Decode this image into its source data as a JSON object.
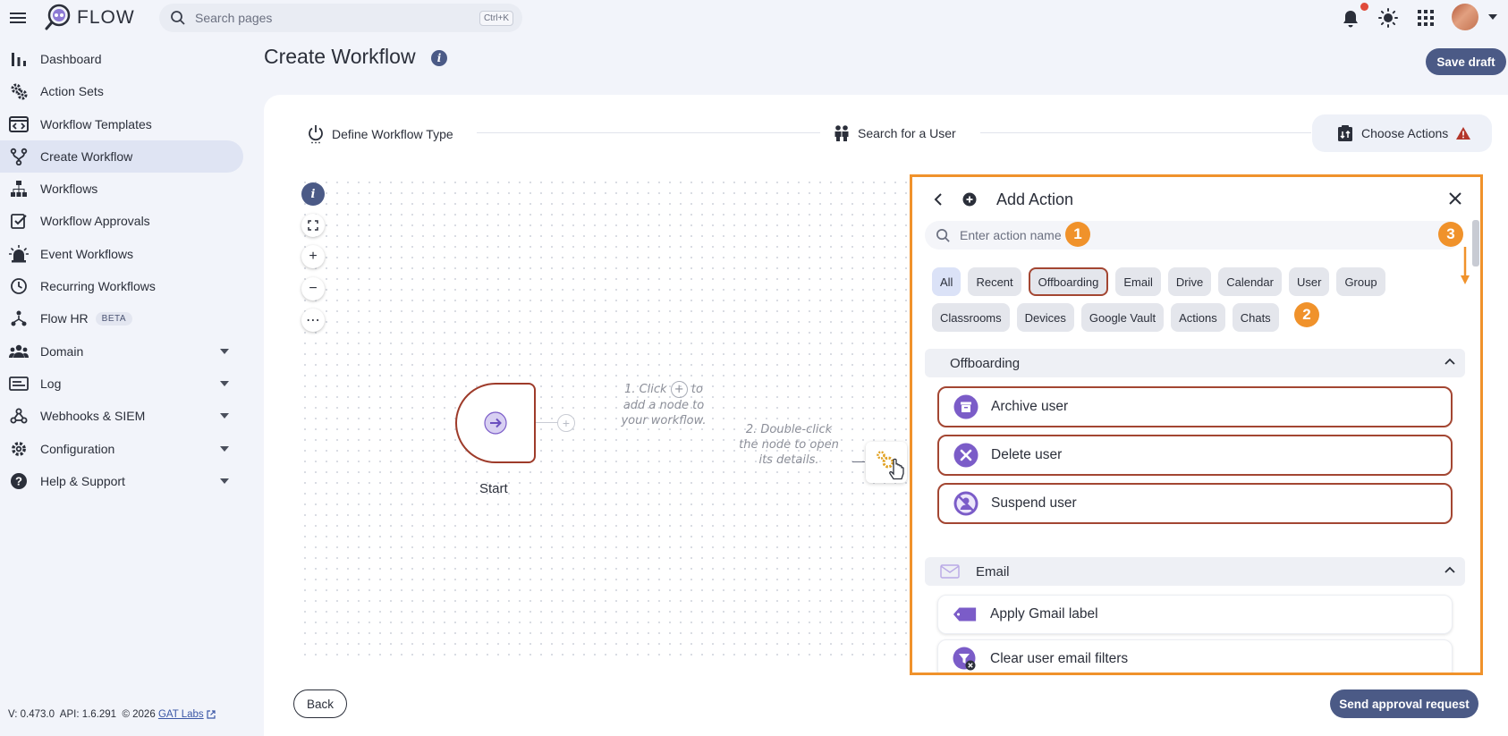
{
  "app": {
    "logo_text": "FLOW"
  },
  "search": {
    "placeholder": "Search pages",
    "shortcut": "Ctrl+K"
  },
  "sidebar": {
    "items": [
      {
        "label": "Dashboard"
      },
      {
        "label": "Action Sets"
      },
      {
        "label": "Workflow Templates"
      },
      {
        "label": "Create Workflow",
        "active": true
      },
      {
        "label": "Workflows"
      },
      {
        "label": "Workflow Approvals"
      },
      {
        "label": "Event Workflows"
      },
      {
        "label": "Recurring Workflows"
      },
      {
        "label": "Flow HR",
        "badge": "BETA"
      },
      {
        "label": "Domain"
      },
      {
        "label": "Log"
      },
      {
        "label": "Webhooks & SIEM"
      },
      {
        "label": "Configuration"
      },
      {
        "label": "Help & Support"
      }
    ]
  },
  "footer": {
    "version": "V: 0.473.0",
    "api": "API: 1.6.291",
    "copyright": "© 2026",
    "link": "GAT Labs"
  },
  "page": {
    "title": "Create Workflow",
    "info_glyph": "i",
    "save_draft": "Save draft"
  },
  "stepper": {
    "steps": [
      {
        "label": "Define Workflow Type"
      },
      {
        "label": "Search for a User"
      },
      {
        "label": "Choose Actions",
        "active": true,
        "warning": true
      }
    ]
  },
  "canvas": {
    "tools": [
      "i",
      "fit",
      "+",
      "−",
      "⋯"
    ],
    "start_label": "Start",
    "hint1": [
      "1. Click",
      "to",
      "add a node to",
      "your workflow."
    ],
    "hint2": [
      "2. Double-click",
      "the node to open",
      "its details."
    ]
  },
  "buttons": {
    "back": "Back",
    "send": "Send approval request"
  },
  "panel": {
    "title": "Add Action",
    "search_placeholder": "Enter action name",
    "badges": [
      "1",
      "2",
      "3"
    ],
    "chips": [
      "All",
      "Recent",
      "Offboarding",
      "Email",
      "Drive",
      "Calendar",
      "User",
      "Group",
      "Classrooms",
      "Devices",
      "Google Vault",
      "Actions",
      "Chats"
    ],
    "selected_chip": "Offboarding",
    "sections": [
      {
        "label": "Offboarding",
        "actions": [
          "Archive user",
          "Delete user",
          "Suspend user"
        ]
      },
      {
        "label": "Email",
        "actions": [
          "Apply Gmail label",
          "Clear user email filters"
        ]
      }
    ]
  },
  "colors": {
    "accent": "#4b5a86",
    "highlight": "#f0922b",
    "selected_border": "#a34632",
    "action_icon": "#7b5cc8"
  }
}
